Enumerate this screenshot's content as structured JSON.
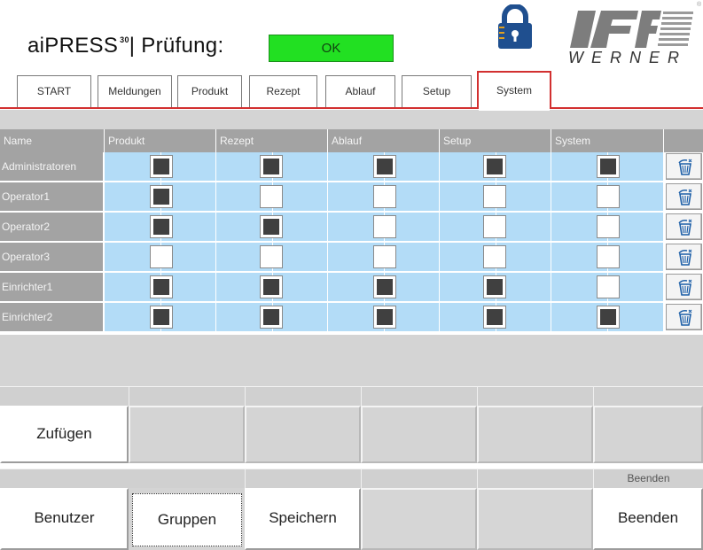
{
  "header": {
    "app_name": "aiPRESS",
    "app_superscript": "30",
    "title_suffix": "| Prüfung:",
    "status": "OK",
    "status_color": "#22e022",
    "lock_icon": "lock-icon",
    "logo_text": "WERNER",
    "logo_mark": "®"
  },
  "tabs": [
    {
      "label": "START",
      "active": false
    },
    {
      "label": "Meldungen",
      "active": false
    },
    {
      "label": "Produkt",
      "active": false
    },
    {
      "label": "Rezept",
      "active": false
    },
    {
      "label": "Ablauf",
      "active": false
    },
    {
      "label": "Setup",
      "active": false
    },
    {
      "label": "System",
      "active": true
    }
  ],
  "table": {
    "columns": [
      "Name",
      "Produkt",
      "Rezept",
      "Ablauf",
      "Setup",
      "System"
    ],
    "rows": [
      {
        "name": "Administratoren",
        "perms": [
          true,
          true,
          true,
          true,
          true
        ]
      },
      {
        "name": "Operator1",
        "perms": [
          true,
          false,
          false,
          false,
          false
        ]
      },
      {
        "name": "Operator2",
        "perms": [
          true,
          true,
          false,
          false,
          false
        ]
      },
      {
        "name": "Operator3",
        "perms": [
          false,
          false,
          false,
          false,
          false
        ]
      },
      {
        "name": "Einrichter1",
        "perms": [
          true,
          true,
          true,
          true,
          false
        ]
      },
      {
        "name": "Einrichter2",
        "perms": [
          true,
          true,
          true,
          true,
          true
        ]
      }
    ],
    "delete_icon": "trash-icon"
  },
  "buttons": {
    "add": "Zufügen",
    "strip2_label": "Beenden",
    "users": "Benutzer",
    "groups": "Gruppen",
    "save": "Speichern",
    "exit": "Beenden"
  }
}
